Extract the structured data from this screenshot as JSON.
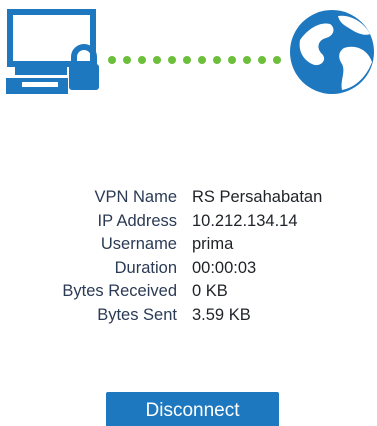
{
  "colors": {
    "accent": "#1e78bf",
    "connection_dots": "#6cbf3a"
  },
  "icons": {
    "left": "computer-lock-icon",
    "connector": "connection-dots-icon",
    "right": "globe-icon"
  },
  "details": [
    {
      "label": "VPN Name",
      "value": "RS Persahabatan"
    },
    {
      "label": "IP Address",
      "value": "10.212.134.14"
    },
    {
      "label": "Username",
      "value": "prima"
    },
    {
      "label": "Duration",
      "value": "00:00:03"
    },
    {
      "label": "Bytes Received",
      "value": "0 KB"
    },
    {
      "label": "Bytes Sent",
      "value": "3.59 KB"
    }
  ],
  "actions": {
    "disconnect_label": "Disconnect"
  }
}
